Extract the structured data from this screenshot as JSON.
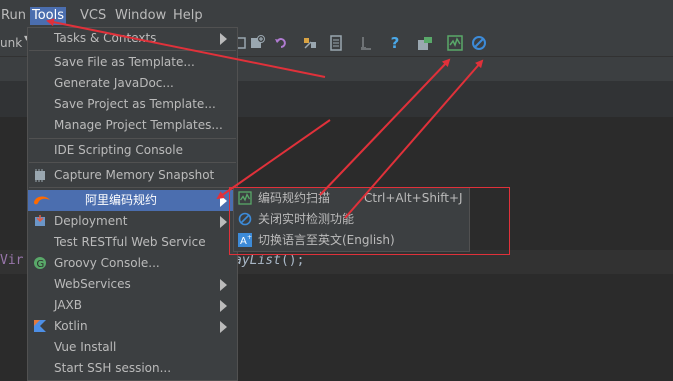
{
  "menubar": {
    "items": [
      {
        "label": "Run"
      },
      {
        "label": "Tools"
      },
      {
        "label": "VCS"
      },
      {
        "label": "Window"
      },
      {
        "label": "Help"
      }
    ]
  },
  "toolbar": {
    "branch_text": "unk",
    "help_glyph": "?",
    "icons": [
      "add-configuration-icon",
      "undo-icon",
      "build-tools-icon",
      "structure-icon",
      "git-icon",
      "help-icon",
      "sdk-icon",
      "scan-code-icon",
      "stop-realtime-check-icon"
    ]
  },
  "tools_menu": {
    "items": [
      {
        "label": "Tasks & Contexts",
        "icon": null,
        "submenu": true
      },
      {
        "label": "Save File as Template...",
        "icon": null,
        "submenu": false
      },
      {
        "label": "Generate JavaDoc...",
        "icon": null,
        "submenu": false
      },
      {
        "label": "Save Project as Template...",
        "icon": null,
        "submenu": false
      },
      {
        "label": "Manage Project Templates...",
        "icon": null,
        "submenu": false
      },
      {
        "label": "IDE Scripting Console",
        "icon": null,
        "submenu": false
      },
      {
        "label": "Capture Memory Snapshot",
        "icon": "memory-snapshot-icon",
        "submenu": false
      },
      {
        "label": "阿里编码规约",
        "icon": "alibaba-icon",
        "submenu": true,
        "selected": true
      },
      {
        "label": "Deployment",
        "icon": "deployment-icon",
        "submenu": true
      },
      {
        "label": "Test RESTful Web Service",
        "icon": null,
        "submenu": false
      },
      {
        "label": "Groovy Console...",
        "icon": "groovy-icon",
        "submenu": false
      },
      {
        "label": "WebServices",
        "icon": null,
        "submenu": true
      },
      {
        "label": "JAXB",
        "icon": null,
        "submenu": true
      },
      {
        "label": "Kotlin",
        "icon": "kotlin-icon",
        "submenu": true
      },
      {
        "label": "Vue Install",
        "icon": null,
        "submenu": false
      },
      {
        "label": "Start SSH session...",
        "icon": null,
        "submenu": false
      }
    ]
  },
  "alibaba_submenu": {
    "items": [
      {
        "label": "编码规约扫描",
        "shortcut": "Ctrl+Alt+Shift+J",
        "icon": "scan-code-icon"
      },
      {
        "label": "关闭实时检测功能",
        "shortcut": "",
        "icon": "stop-realtime-check-icon"
      },
      {
        "label": "切换语言至英文(English)",
        "shortcut": "",
        "icon": "switch-language-icon"
      }
    ]
  },
  "editor": {
    "code_left": "Vir",
    "code_right_italic": "ayList",
    "code_right_rest": "();"
  },
  "colors": {
    "menu_bg": "#3c3f41",
    "selection": "#4b6eaf",
    "annotation_red": "#e0313a",
    "editor_bg": "#2b2b2b"
  }
}
